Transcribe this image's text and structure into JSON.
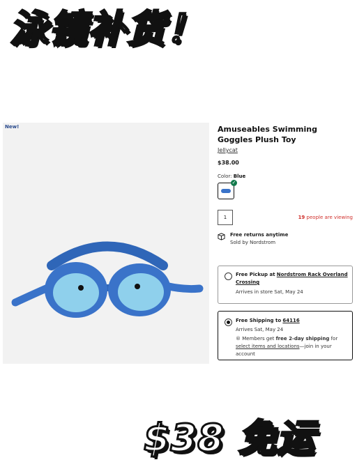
{
  "banners": {
    "top": "泳镜补货！",
    "bottom": "$38 免运"
  },
  "product": {
    "badge": "New!",
    "title": "Amuseables Swimming Goggles Plush Toy",
    "brand": "Jellycat",
    "price": "$38.00",
    "color_label": "Color:",
    "color_value": "Blue",
    "quantity": "1",
    "viewing_count": "19",
    "viewing_text": "people are viewing",
    "returns_title": "Free returns anytime",
    "sold_by": "Sold by Nordstrom",
    "colors": {
      "goggle_blue": "#3a73c9",
      "lens": "#8fd0ec",
      "check": "#12794b",
      "alert": "#d0312d"
    }
  },
  "pickup": {
    "prefix": "Free Pickup at",
    "store": "Nordstrom Rack Overland Crossing",
    "arrival": "Arrives in store Sat, May 24"
  },
  "shipping": {
    "prefix": "Free Shipping to",
    "zip": "64116",
    "arrival": "Arrives Sat, May 24",
    "members_pre": "Members get",
    "members_bold": "free 2-day shipping",
    "members_mid": "for",
    "members_link": "select items and locations",
    "members_post": "—join in your account"
  }
}
